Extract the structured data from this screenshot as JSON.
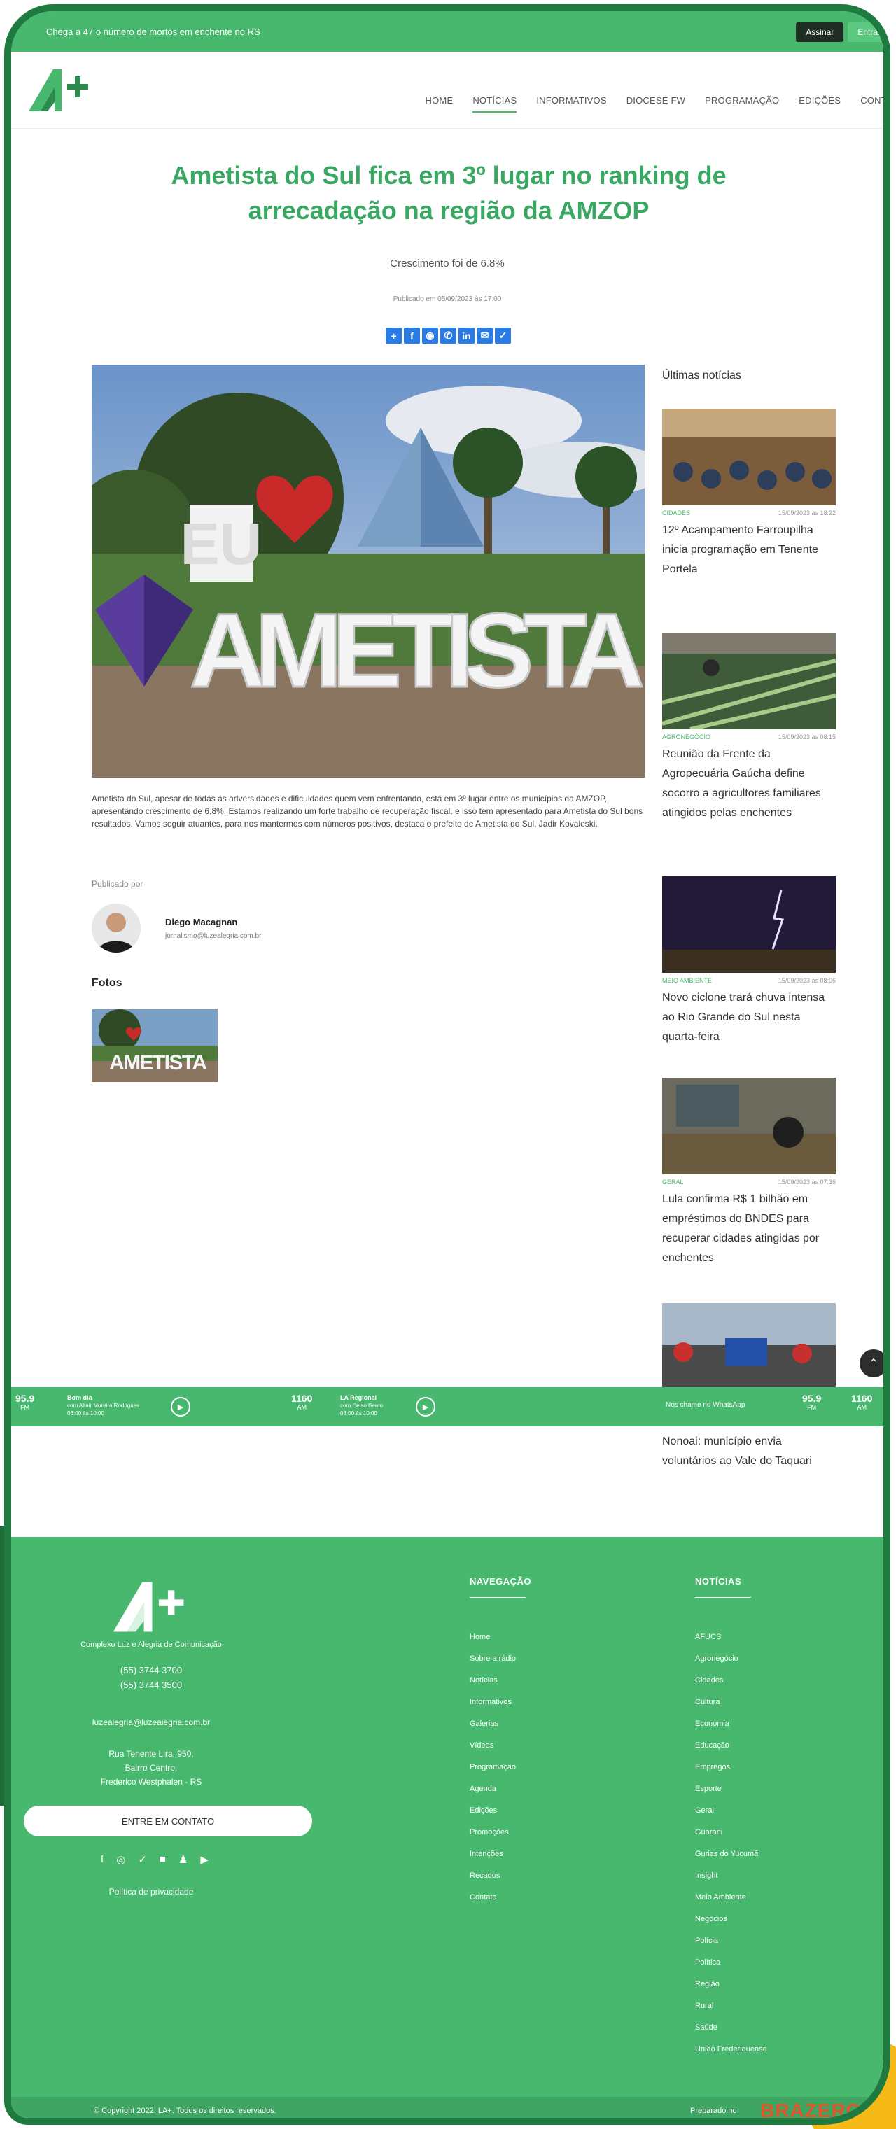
{
  "topbar": {
    "ticker": "Chega a 47 o número de mortos em enchente no RS",
    "subscribe_label": "Assinar",
    "login_label": "Entrar"
  },
  "nav": {
    "items": [
      "HOME",
      "NOTÍCIAS",
      "INFORMATIVOS",
      "DIOCESE FW",
      "PROGRAMAÇÃO",
      "EDIÇÕES",
      "CONTATO"
    ],
    "active": "NOTÍCIAS"
  },
  "article": {
    "title": "Ametista do Sul fica em 3º lugar no ranking de arrecadação na região da AMZOP",
    "subtitle": "Crescimento foi de 6.8%",
    "published": "Publicado em 05/09/2023 às 17:00",
    "body": "Ametista do Sul, apesar de todas as adversidades e dificuldades quem vem enfrentando, está em 3º lugar entre os municípios da AMZOP, apresentando crescimento de 6,8%. Estamos realizando um forte trabalho de recuperação fiscal, e isso tem apresentado para Ametista do Sul bons resultados. Vamos seguir atuantes, para nos mantermos com números positivos, destaca o prefeito de Ametista do Sul, Jadir Kovaleski.",
    "image_sign": "EU AMETISTA",
    "published_by_label": "Publicado por",
    "author_name": "Diego Macagnan",
    "author_email": "jornalismo@luzealegria.com.br",
    "photos_label": "Fotos"
  },
  "share_icons": [
    "plus-icon",
    "facebook-icon",
    "messenger-icon",
    "whatsapp-icon",
    "linkedin-icon",
    "email-icon",
    "twitter-icon"
  ],
  "sidebar": {
    "heading": "Últimas notícias",
    "items": [
      {
        "category": "CIDADES",
        "date": "15/09/2023 às 18:22",
        "title": "12º Acampamento Farroupilha inicia programação em Tenente Portela"
      },
      {
        "category": "AGRONEGÓCIO",
        "date": "15/09/2023 às 08:15",
        "title": "Reunião da Frente da Agropecuária Gaúcha define socorro a agricultores familiares atingidos pelas enchentes"
      },
      {
        "category": "MEIO AMBIENTE",
        "date": "15/09/2023 às 08:06",
        "title": "Novo ciclone trará chuva intensa ao Rio Grande do Sul nesta quarta-feira"
      },
      {
        "category": "GERAL",
        "date": "15/09/2023 às 07:35",
        "title": "Lula confirma R$ 1 bilhão em empréstimos do BNDES para recuperar cidades atingidas por enchentes"
      },
      {
        "category": "",
        "date": "",
        "title": "Nonoai: município envia voluntários ao Vale do Taquari"
      }
    ]
  },
  "radio": {
    "station1": {
      "freq": "95.9",
      "unit": "FM",
      "program": "Bom dia",
      "host": "com Altair Moreira Rodrigues",
      "time": "06:00 às 10:00"
    },
    "station2": {
      "freq": "1160",
      "unit": "AM",
      "program": "LA Regional",
      "host": "com Celso Beato",
      "time": "08:00 às 10:00"
    },
    "whatsapp_text": "Nos chame no WhatsApp",
    "right_freq1": "95.9",
    "right_unit1": "FM",
    "right_freq2": "1160",
    "right_unit2": "AM"
  },
  "footer": {
    "company": "Complexo Luz e Alegria de Comunicação",
    "phone1": "(55) 3744 3700",
    "phone2": "(55) 3744 3500",
    "email": "luzealegria@luzealegria.com.br",
    "address1": "Rua Tenente Lira, 950,",
    "address2": "Bairro Centro,",
    "address3": "Frederico Westphalen - RS",
    "contact_button": "ENTRE EM CONTATO",
    "privacy": "Política de privacidade",
    "nav_heading": "NAVEGAÇÃO",
    "nav_items": [
      "Home",
      "Sobre a rádio",
      "Notícias",
      "Informativos",
      "Galerias",
      "Vídeos",
      "Programação",
      "Agenda",
      "Edições",
      "Promoções",
      "Intenções",
      "Recados",
      "Contato"
    ],
    "news_heading": "NOTÍCIAS",
    "news_items": [
      "AFUCS",
      "Agronegócio",
      "Cidades",
      "Cultura",
      "Economia",
      "Educação",
      "Empregos",
      "Esporte",
      "Geral",
      "Guarani",
      "Gurias do Yucumã",
      "Insight",
      "Meio Ambiente",
      "Negócios",
      "Polícia",
      "Política",
      "Região",
      "Rural",
      "Saúde",
      "União Frederiquense"
    ],
    "copyright": "© Copyright 2022. LA+. Todos os direitos reservados.",
    "dev_label": "Preparado no",
    "dev_logo": "BRAZERO"
  }
}
